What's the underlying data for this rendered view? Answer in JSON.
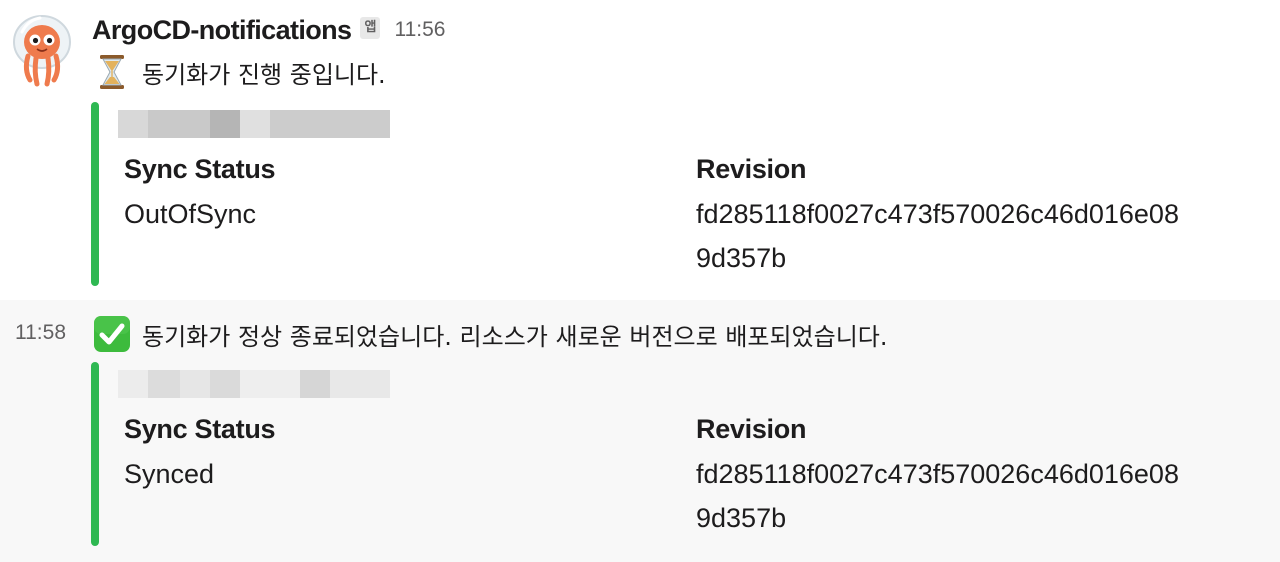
{
  "sender": {
    "name": "ArgoCD-notifications",
    "app_badge": "앱",
    "avatar_icon": "octopus-avatar-icon"
  },
  "messages": [
    {
      "timestamp": "11:56",
      "emoji": "hourglass-icon",
      "text": "동기화가 진행 중입니다.",
      "attachment": {
        "color": "#2eb852",
        "fields": [
          {
            "title": "Sync Status",
            "value": "OutOfSync"
          },
          {
            "title": "Revision",
            "value_line1": "fd285118f0027c473f570026c46d016e08",
            "value_line2": "9d357b"
          }
        ]
      }
    },
    {
      "timestamp": "11:58",
      "emoji": "check-mark-button-icon",
      "text": "동기화가 정상 종료되었습니다. 리소스가 새로운 버전으로 배포되었습니다.",
      "attachment": {
        "color": "#2eb852",
        "fields": [
          {
            "title": "Sync Status",
            "value": "Synced"
          },
          {
            "title": "Revision",
            "value_line1": "fd285118f0027c473f570026c46d016e08",
            "value_line2": "9d357b"
          }
        ]
      }
    }
  ]
}
